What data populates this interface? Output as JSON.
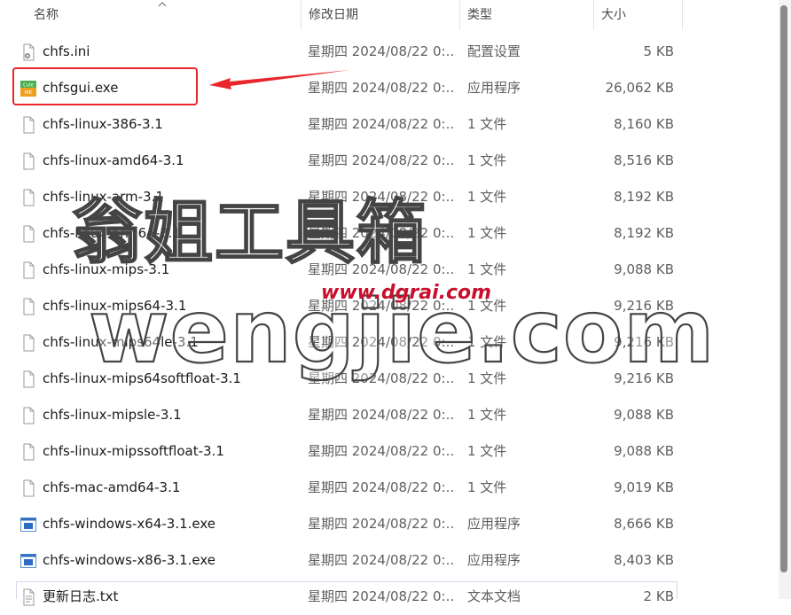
{
  "header": {
    "name": "名称",
    "date": "修改日期",
    "type": "类型",
    "size": "大小"
  },
  "files": [
    {
      "name": "chfs.ini",
      "date": "星期四 2024/08/22 0:...",
      "type": "配置设置",
      "size": "5 KB",
      "icon": "config-file-icon"
    },
    {
      "name": "chfsgui.exe",
      "date": "星期四 2024/08/22 0:...",
      "type": "应用程序",
      "size": "26,062 KB",
      "icon": "cute-me-app-icon"
    },
    {
      "name": "chfs-linux-386-3.1",
      "date": "星期四 2024/08/22 0:...",
      "type": "1 文件",
      "size": "8,160 KB",
      "icon": "blank-file-icon"
    },
    {
      "name": "chfs-linux-amd64-3.1",
      "date": "星期四 2024/08/22 0:...",
      "type": "1 文件",
      "size": "8,516 KB",
      "icon": "blank-file-icon"
    },
    {
      "name": "chfs-linux-arm-3.1",
      "date": "星期四 2024/08/22 0:...",
      "type": "1 文件",
      "size": "8,192 KB",
      "icon": "blank-file-icon"
    },
    {
      "name": "chfs-linux-arm64-3.1",
      "date": "星期四 2024/08/22 0:...",
      "type": "1 文件",
      "size": "8,192 KB",
      "icon": "blank-file-icon"
    },
    {
      "name": "chfs-linux-mips-3.1",
      "date": "星期四 2024/08/22 0:...",
      "type": "1 文件",
      "size": "9,088 KB",
      "icon": "blank-file-icon"
    },
    {
      "name": "chfs-linux-mips64-3.1",
      "date": "星期四 2024/08/22 0:...",
      "type": "1 文件",
      "size": "9,216 KB",
      "icon": "blank-file-icon"
    },
    {
      "name": "chfs-linux-mips64le-3.1",
      "date": "星期四 2024/08/22 0:...",
      "type": "1 文件",
      "size": "9,216 KB",
      "icon": "blank-file-icon"
    },
    {
      "name": "chfs-linux-mips64softfloat-3.1",
      "date": "星期四 2024/08/22 0:...",
      "type": "1 文件",
      "size": "9,216 KB",
      "icon": "blank-file-icon"
    },
    {
      "name": "chfs-linux-mipsle-3.1",
      "date": "星期四 2024/08/22 0:...",
      "type": "1 文件",
      "size": "9,088 KB",
      "icon": "blank-file-icon"
    },
    {
      "name": "chfs-linux-mipssoftfloat-3.1",
      "date": "星期四 2024/08/22 0:...",
      "type": "1 文件",
      "size": "9,088 KB",
      "icon": "blank-file-icon"
    },
    {
      "name": "chfs-mac-amd64-3.1",
      "date": "星期四 2024/08/22 0:...",
      "type": "1 文件",
      "size": "9,019 KB",
      "icon": "blank-file-icon"
    },
    {
      "name": "chfs-windows-x64-3.1.exe",
      "date": "星期四 2024/08/22 0:...",
      "type": "应用程序",
      "size": "8,666 KB",
      "icon": "exe-app-icon"
    },
    {
      "name": "chfs-windows-x86-3.1.exe",
      "date": "星期四 2024/08/22 0:...",
      "type": "应用程序",
      "size": "8,403 KB",
      "icon": "exe-app-icon"
    },
    {
      "name": "更新日志.txt",
      "date": "星期四 2024/08/22 0:...",
      "type": "文本文档",
      "size": "2 KB",
      "icon": "text-file-icon"
    }
  ],
  "watermark": {
    "title_cn": "翁姐工具箱",
    "site": "wengjie.com",
    "url": "www.dgrai.com"
  },
  "colors": {
    "highlight": "#e8262b",
    "watermark_url": "#c8102e"
  }
}
